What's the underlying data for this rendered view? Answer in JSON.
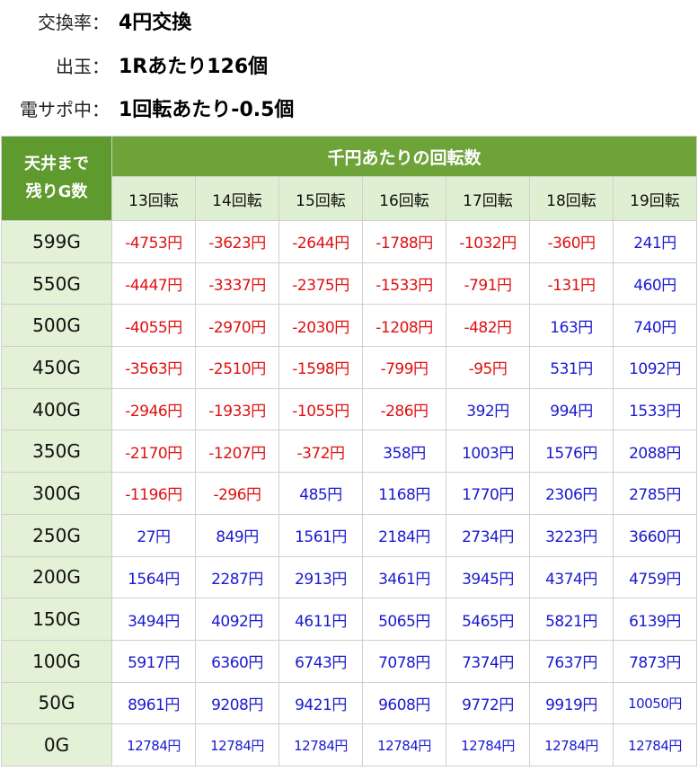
{
  "info": {
    "exchange_label": "交換率：",
    "exchange_value": "4円交換",
    "payout_label": "出玉：",
    "payout_value": "1Rあたり126個",
    "support_label": "電サポ中：",
    "support_value": "1回転あたり-0.5個"
  },
  "table": {
    "corner_line1": "天井まで",
    "corner_line2": "残りG数",
    "group_header": "千円あたりの回転数",
    "columns": [
      "13回転",
      "14回転",
      "15回転",
      "16回転",
      "17回転",
      "18回転",
      "19回転"
    ],
    "rows": [
      {
        "label": "599G",
        "values": [
          "-4753円",
          "-3623円",
          "-2644円",
          "-1788円",
          "-1032円",
          "-360円",
          "241円"
        ]
      },
      {
        "label": "550G",
        "values": [
          "-4447円",
          "-3337円",
          "-2375円",
          "-1533円",
          "-791円",
          "-131円",
          "460円"
        ]
      },
      {
        "label": "500G",
        "values": [
          "-4055円",
          "-2970円",
          "-2030円",
          "-1208円",
          "-482円",
          "163円",
          "740円"
        ]
      },
      {
        "label": "450G",
        "values": [
          "-3563円",
          "-2510円",
          "-1598円",
          "-799円",
          "-95円",
          "531円",
          "1092円"
        ]
      },
      {
        "label": "400G",
        "values": [
          "-2946円",
          "-1933円",
          "-1055円",
          "-286円",
          "392円",
          "994円",
          "1533円"
        ]
      },
      {
        "label": "350G",
        "values": [
          "-2170円",
          "-1207円",
          "-372円",
          "358円",
          "1003円",
          "1576円",
          "2088円"
        ]
      },
      {
        "label": "300G",
        "values": [
          "-1196円",
          "-296円",
          "485円",
          "1168円",
          "1770円",
          "2306円",
          "2785円"
        ]
      },
      {
        "label": "250G",
        "values": [
          "27円",
          "849円",
          "1561円",
          "2184円",
          "2734円",
          "3223円",
          "3660円"
        ]
      },
      {
        "label": "200G",
        "values": [
          "1564円",
          "2287円",
          "2913円",
          "3461円",
          "3945円",
          "4374円",
          "4759円"
        ]
      },
      {
        "label": "150G",
        "values": [
          "3494円",
          "4092円",
          "4611円",
          "5065円",
          "5465円",
          "5821円",
          "6139円"
        ]
      },
      {
        "label": "100G",
        "values": [
          "5917円",
          "6360円",
          "6743円",
          "7078円",
          "7374円",
          "7637円",
          "7873円"
        ]
      },
      {
        "label": "50G",
        "values": [
          "8961円",
          "9208円",
          "9421円",
          "9608円",
          "9772円",
          "9919円",
          "10050円"
        ]
      },
      {
        "label": "0G",
        "values": [
          "12784円",
          "12784円",
          "12784円",
          "12784円",
          "12784円",
          "12784円",
          "12784円"
        ]
      }
    ]
  },
  "colors": {
    "negative": "#e01010",
    "positive": "#1a1ad0",
    "header_green": "#6ea33a",
    "corner_green": "#5f9a2e",
    "light_green": "#dff0d2"
  }
}
